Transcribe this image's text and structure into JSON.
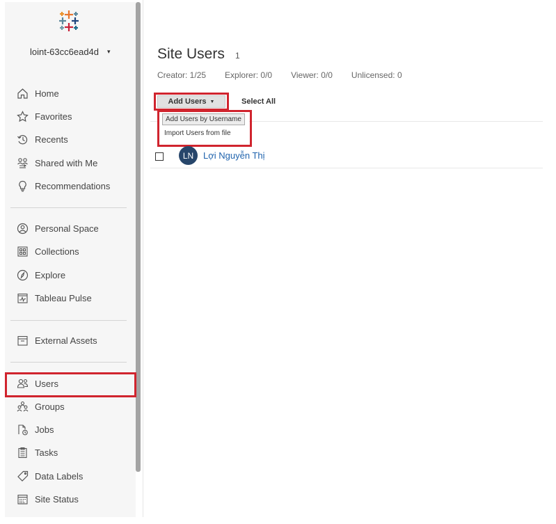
{
  "colors": {
    "accent_red": "#d0242e",
    "link_blue": "#1f63ad",
    "avatar_bg": "#27466b",
    "sidebar_bg": "#f6f6f6"
  },
  "sidebar": {
    "logo_icon": "tableau-logo-icon",
    "site_name": "loint-63cc6ead4d",
    "site_caret": "▾",
    "group1": [
      {
        "label": "Home",
        "icon": "home-icon"
      },
      {
        "label": "Favorites",
        "icon": "star-icon"
      },
      {
        "label": "Recents",
        "icon": "history-icon"
      },
      {
        "label": "Shared with Me",
        "icon": "shared-users-icon"
      },
      {
        "label": "Recommendations",
        "icon": "lightbulb-icon"
      }
    ],
    "group2": [
      {
        "label": "Personal Space",
        "icon": "person-circle-icon"
      },
      {
        "label": "Collections",
        "icon": "collections-icon"
      },
      {
        "label": "Explore",
        "icon": "compass-icon"
      },
      {
        "label": "Tableau Pulse",
        "icon": "pulse-icon"
      }
    ],
    "group3": [
      {
        "label": "External Assets",
        "icon": "archive-box-icon"
      }
    ],
    "group4": [
      {
        "label": "Users",
        "icon": "users-icon",
        "selected": true
      },
      {
        "label": "Groups",
        "icon": "groups-icon"
      },
      {
        "label": "Jobs",
        "icon": "jobs-icon"
      },
      {
        "label": "Tasks",
        "icon": "tasks-clipboard-icon"
      },
      {
        "label": "Data Labels",
        "icon": "tag-icon"
      },
      {
        "label": "Site Status",
        "icon": "site-status-icon"
      }
    ]
  },
  "main": {
    "title": "Site Users",
    "count": "1",
    "licenses": [
      "Creator: 1/25",
      "Explorer: 0/0",
      "Viewer: 0/0",
      "Unlicensed: 0"
    ],
    "add_users_label": "Add Users",
    "add_users_caret": "▼",
    "select_all_label": "Select All",
    "dropdown": {
      "item_by_username": "Add Users by Username",
      "item_import": "Import Users from file"
    },
    "users": [
      {
        "initials": "LN",
        "name": "Lợi Nguyễn Thị"
      }
    ]
  }
}
